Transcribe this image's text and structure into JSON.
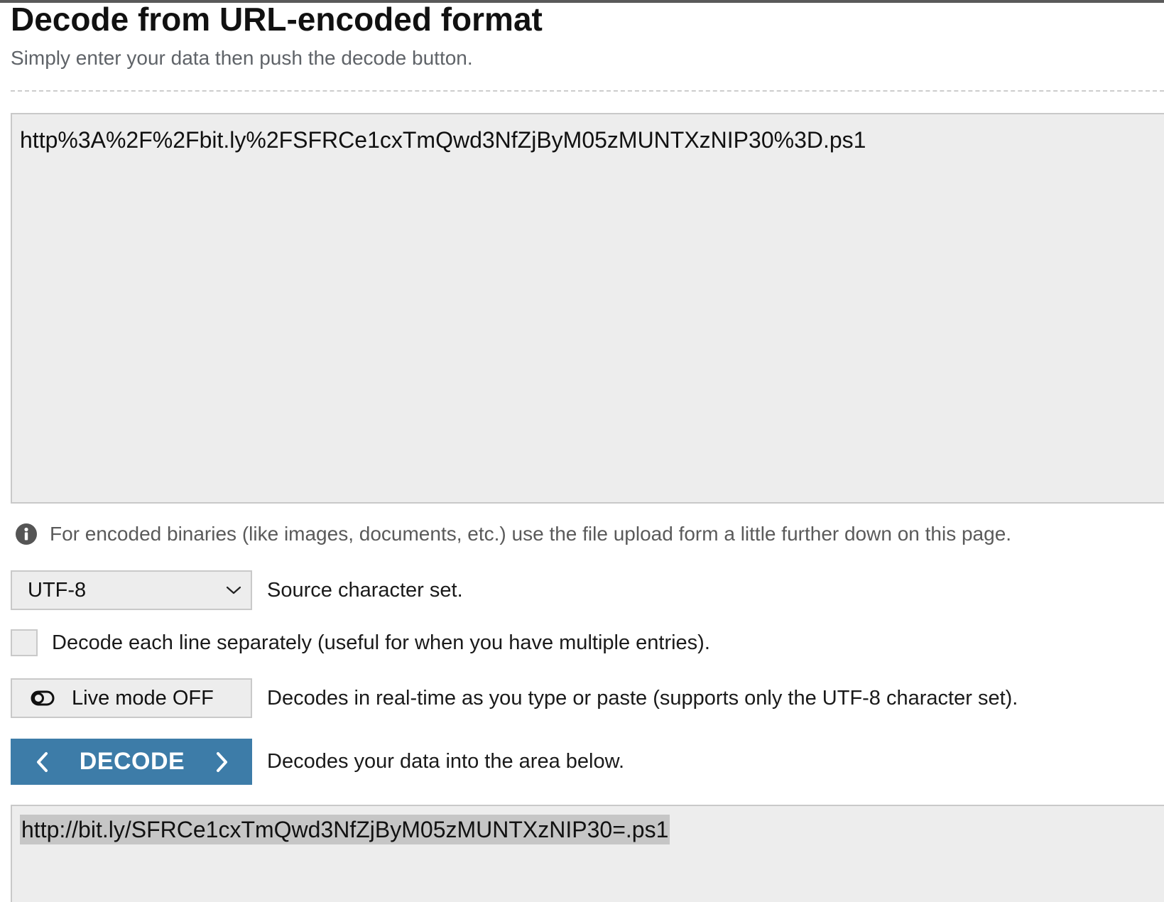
{
  "header": {
    "title": "Decode from URL-encoded format",
    "subtitle": "Simply enter your data then push the decode button."
  },
  "input": {
    "value": "http%3A%2F%2Fbit.ly%2FSFRCe1cxTmQwd3NfZjByM05zMUNTXzNIP30%3D.ps1"
  },
  "hint": {
    "icon": "info-icon",
    "text": "For encoded binaries (like images, documents, etc.) use the file upload form a little further down on this page."
  },
  "charset": {
    "selected": "UTF-8",
    "description": "Source character set."
  },
  "separate_lines": {
    "checked": false,
    "label": "Decode each line separately (useful for when you have multiple entries)."
  },
  "live_mode": {
    "label": "Live mode OFF",
    "description": "Decodes in real-time as you type or paste (supports only the UTF-8 character set)."
  },
  "decode": {
    "label": "DECODE",
    "description": "Decodes your data into the area below.",
    "color": "#3d7ca8"
  },
  "output": {
    "value": "http://bit.ly/SFRCe1cxTmQwd3NfZjByM05zMUNTXzNIP30=.ps1"
  }
}
